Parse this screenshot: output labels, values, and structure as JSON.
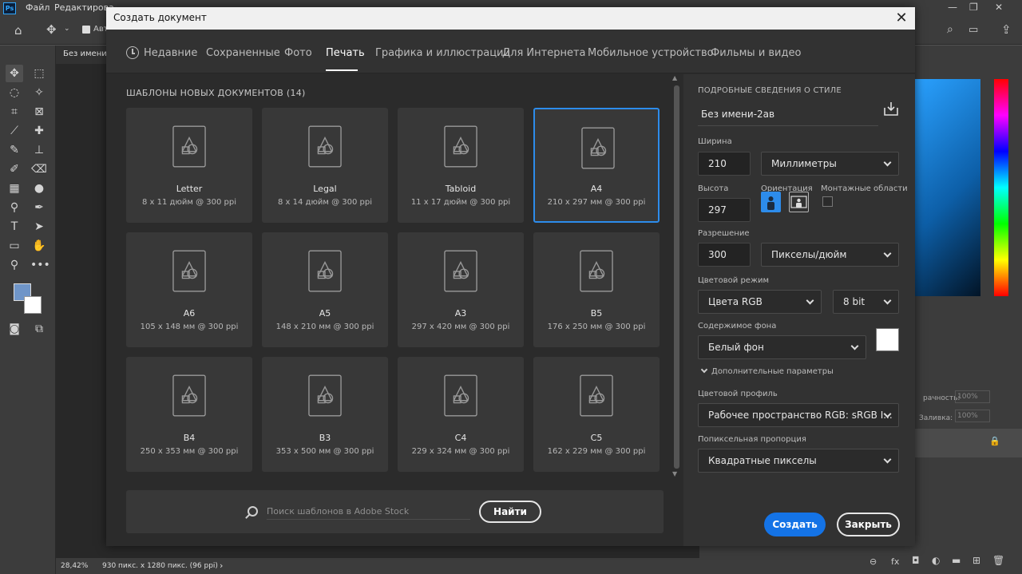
{
  "app": {
    "logo": "Ps",
    "menu": [
      "Файл",
      "Редактирова"
    ],
    "doc_tab": "Без имени",
    "auto_label": "Авт",
    "status_zoom": "28,42%",
    "status_info": "930 пикс. x 1280 пикс. (96 ppi)"
  },
  "right_panel_fragments": {
    "opacity_label": "рачность:",
    "opacity_value": "100%",
    "fill_label": "Заливка:",
    "fill_value": "100%"
  },
  "dialog": {
    "title": "Создать документ",
    "tabs": [
      {
        "label": "Недавние",
        "active": false
      },
      {
        "label": "Сохраненные",
        "active": false
      },
      {
        "label": "Фото",
        "active": false
      },
      {
        "label": "Печать",
        "active": true
      },
      {
        "label": "Графика и иллюстрации",
        "active": false
      },
      {
        "label": "Для Интернета",
        "active": false
      },
      {
        "label": "Мобильное устройство",
        "active": false
      },
      {
        "label": "Фильмы и видео",
        "active": false
      }
    ],
    "templates_heading": "ШАБЛОНЫ НОВЫХ ДОКУМЕНТОВ",
    "templates_count": "(14)",
    "templates": [
      {
        "name": "Letter",
        "meta": "8 x 11 дюйм @ 300 ppi",
        "selected": false
      },
      {
        "name": "Legal",
        "meta": "8 x 14 дюйм @ 300 ppi",
        "selected": false
      },
      {
        "name": "Tabloid",
        "meta": "11 x 17 дюйм @ 300 ppi",
        "selected": false
      },
      {
        "name": "A4",
        "meta": "210 x 297 мм @ 300 ppi",
        "selected": true
      },
      {
        "name": "A6",
        "meta": "105 x 148 мм @ 300 ppi",
        "selected": false
      },
      {
        "name": "A5",
        "meta": "148 x 210 мм @ 300 ppi",
        "selected": false
      },
      {
        "name": "A3",
        "meta": "297 x 420 мм @ 300 ppi",
        "selected": false
      },
      {
        "name": "B5",
        "meta": "176 x 250 мм @ 300 ppi",
        "selected": false
      },
      {
        "name": "B4",
        "meta": "250 x 353 мм @ 300 ppi",
        "selected": false
      },
      {
        "name": "B3",
        "meta": "353 x 500 мм @ 300 ppi",
        "selected": false
      },
      {
        "name": "C4",
        "meta": "229 x 324 мм @ 300 ppi",
        "selected": false
      },
      {
        "name": "C5",
        "meta": "162 x 229 мм @ 300 ppi",
        "selected": false
      }
    ],
    "search": {
      "placeholder": "Поиск шаблонов в Adobe Stock",
      "button": "Найти"
    },
    "details": {
      "heading": "ПОДРОБНЫЕ СВЕДЕНИЯ О СТИЛЕ",
      "preset_name": "Без имени-2ав",
      "width_label": "Ширина",
      "width_value": "210",
      "width_unit": "Миллиметры",
      "height_label": "Высота",
      "height_value": "297",
      "orientation_label": "Ориентация",
      "artboards_label": "Монтажные области",
      "resolution_label": "Разрешение",
      "resolution_value": "300",
      "resolution_unit": "Пикселы/дюйм",
      "color_mode_label": "Цветовой режим",
      "color_mode_value": "Цвета RGB",
      "bit_depth_value": "8 bit",
      "bg_label": "Содержимое фона",
      "bg_value": "Белый фон",
      "bg_color": "#ffffff",
      "advanced_label": "Дополнительные параметры",
      "profile_label": "Цветовой профиль",
      "profile_value": "Рабочее пространство RGB: sRGB I...",
      "pixel_ratio_label": "Попиксельная пропорция",
      "pixel_ratio_value": "Квадратные пикселы",
      "create_button": "Создать",
      "close_button": "Закрыть"
    }
  },
  "colors": {
    "accent": "#2d8ceb",
    "create_button": "#1473e6",
    "foreground_swatch": "#6f95c8",
    "background_swatch": "#ffffff"
  }
}
